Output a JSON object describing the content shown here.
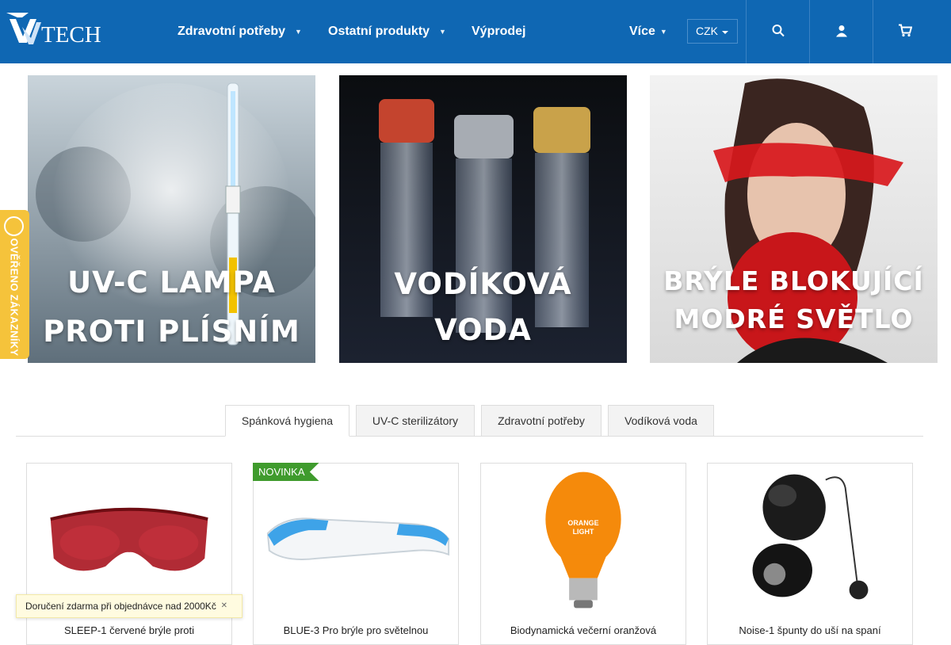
{
  "header": {
    "logo_text": "UVTECH",
    "nav": [
      {
        "label": "Zdravotní potřeby",
        "has_dropdown": true
      },
      {
        "label": "Ostatní produkty",
        "has_dropdown": true
      },
      {
        "label": "Výprodej",
        "has_dropdown": false
      },
      {
        "label": "Více",
        "has_dropdown": true
      }
    ],
    "currency": "CZK",
    "icons": [
      "search-icon",
      "user-icon",
      "cart-icon"
    ],
    "bg_color": "#0f67b3"
  },
  "banners": [
    {
      "line1": "UV-C LAMPA",
      "line2": "PROTI PLÍSNÍM"
    },
    {
      "line1": "VODÍKOVÁ",
      "line2": "VODA"
    },
    {
      "line1": "BRÝLE BLOKUJÍCÍ",
      "line2": "MODRÉ SVĚTLO"
    }
  ],
  "verified_badge": {
    "label": "OVĚŘENO ZÁKAZNÍKY",
    "color": "#f5c33b"
  },
  "tabs": [
    {
      "label": "Spánková hygiena",
      "active": true
    },
    {
      "label": "UV-C sterilizátory",
      "active": false
    },
    {
      "label": "Zdravotní potřeby",
      "active": false
    },
    {
      "label": "Vodíková voda",
      "active": false
    }
  ],
  "products": [
    {
      "title": "SLEEP-1 červené brýle proti",
      "badge": ""
    },
    {
      "title": "BLUE-3 Pro brýle pro světelnou",
      "badge": "NOVINKA"
    },
    {
      "title": "Biodynamická večerní oranžová",
      "badge": ""
    },
    {
      "title": "Noise-1 špunty do uší na spaní",
      "badge": ""
    }
  ],
  "shipping_bar": {
    "text": "Doručení zdarma při objednávce nad 2000Kč",
    "close_icon": "close-icon"
  }
}
